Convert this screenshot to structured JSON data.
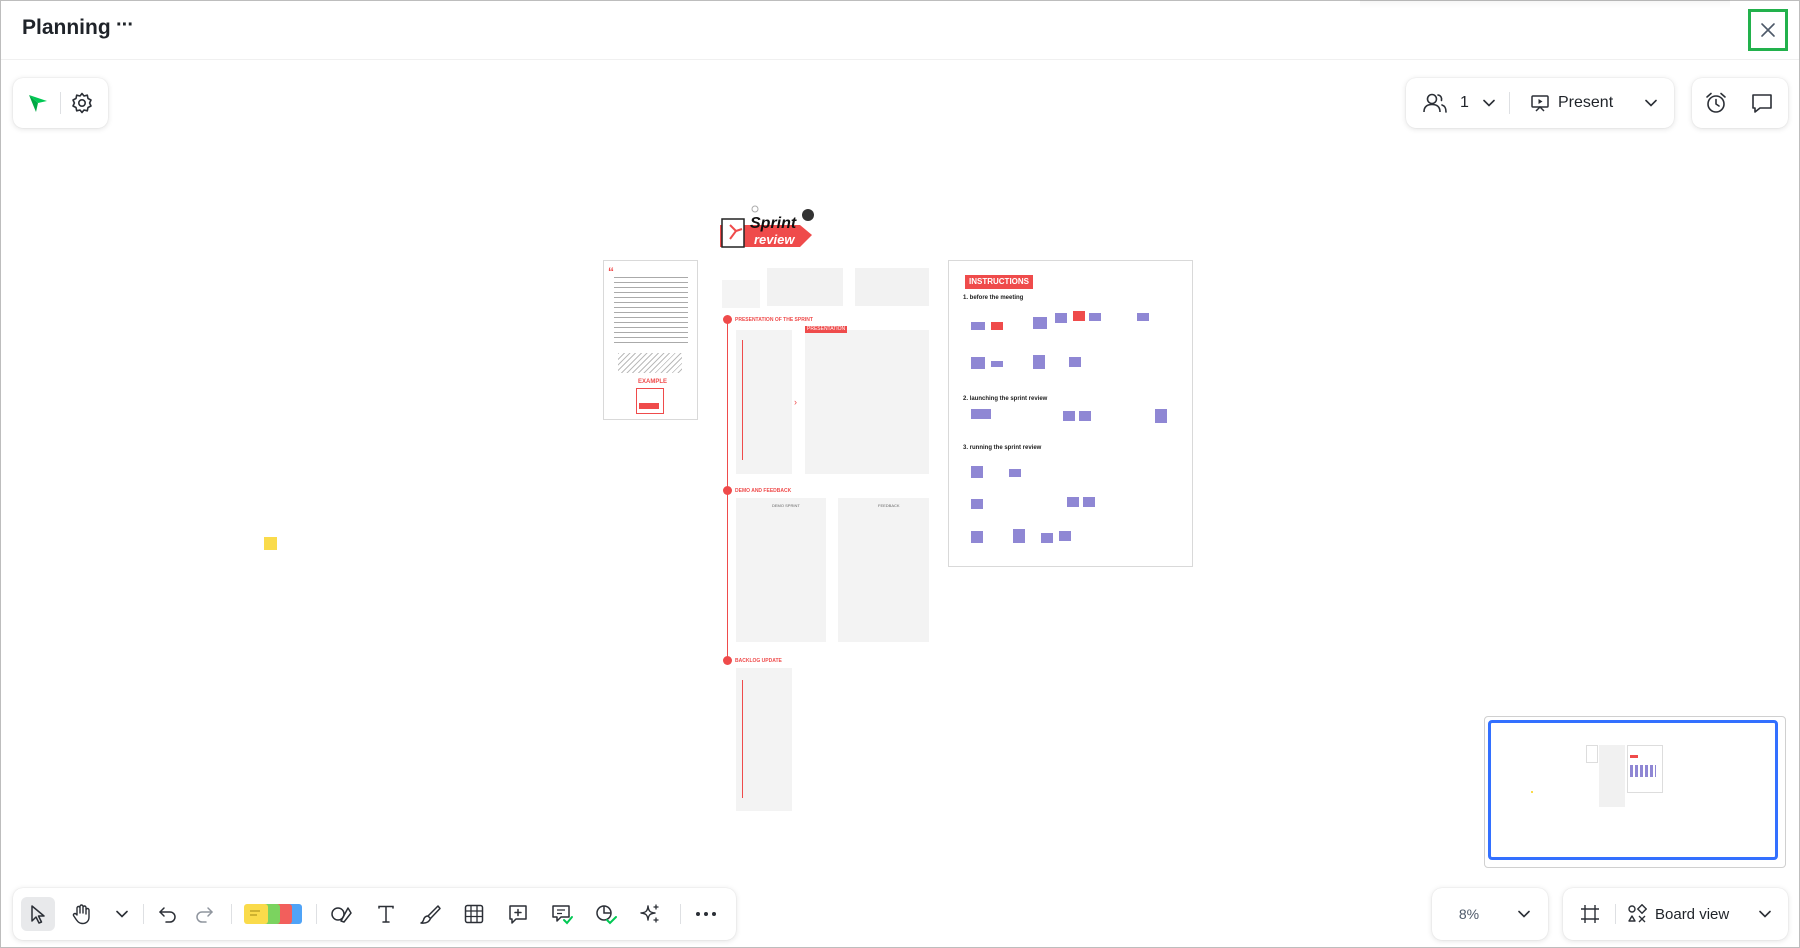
{
  "header": {
    "title": "Planning",
    "more_label": "···"
  },
  "top_right": {
    "collaborators_count": "1",
    "present_label": "Present"
  },
  "board": {
    "sprint_title_1": "Sprint",
    "sprint_title_2": "review",
    "instructions_heading": "INSTRUCTIONS",
    "step1": "1. before the meeting",
    "step2": "2. launching the sprint review",
    "step3": "3. running the sprint review",
    "example_label": "EXAMPLE",
    "section1": "PRESENTATION OF THE SPRINT",
    "section2": "DEMO AND FEEDBACK",
    "section3": "BACKLOG UPDATE",
    "demo_col": "DEMO SPRINT",
    "feedback_col": "FEEDBACK",
    "presentation_tag": "PRESENTATION"
  },
  "bottom_bar": {
    "zoom_value": "8%",
    "board_view_label": "Board view"
  },
  "colors": {
    "accent_green": "#00c853",
    "close_highlight": "#22b14c",
    "minimap_border": "#3370ff",
    "sprint_red": "#ef4b4b",
    "sticky_yellow": "#fadb4b",
    "note_purple": "#8f87d4"
  }
}
